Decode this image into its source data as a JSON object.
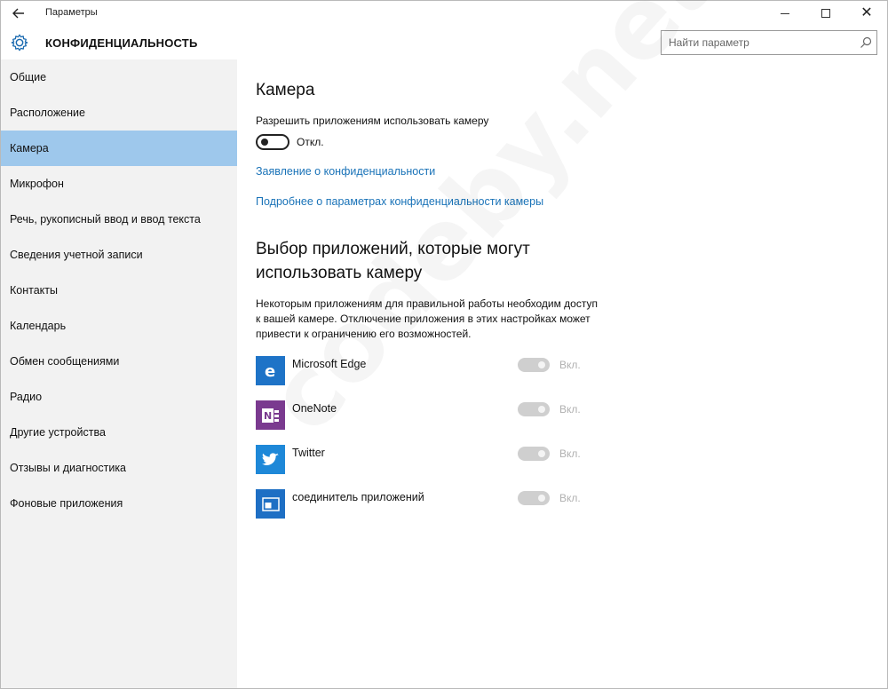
{
  "window": {
    "title": "Параметры",
    "back_icon": "arrow-left-icon",
    "controls": [
      "minimize-icon",
      "maximize-icon",
      "close-icon"
    ]
  },
  "header": {
    "title": "КОНФИДЕНЦИАЛЬНОСТЬ",
    "icon": "gear-icon",
    "search_placeholder": "Найти параметр",
    "search_icon": "search-icon"
  },
  "sidebar": {
    "active_index": 2,
    "items": [
      {
        "label": "Общие"
      },
      {
        "label": "Расположение"
      },
      {
        "label": "Камера"
      },
      {
        "label": "Микрофон"
      },
      {
        "label": "Речь, рукописный ввод и ввод текста"
      },
      {
        "label": "Сведения учетной записи"
      },
      {
        "label": "Контакты"
      },
      {
        "label": "Календарь"
      },
      {
        "label": "Обмен сообщениями"
      },
      {
        "label": "Радио"
      },
      {
        "label": "Другие устройства"
      },
      {
        "label": "Отзывы и диагностика"
      },
      {
        "label": "Фоновые приложения"
      }
    ]
  },
  "main": {
    "title": "Камера",
    "allow_label": "Разрешить приложениям использовать камеру",
    "allow_toggle": {
      "on": false,
      "state_label": "Откл."
    },
    "links": [
      "Заявление о конфиденциальности",
      "Подробнее о параметрах конфиденциальности камеры"
    ],
    "section_title": "Выбор приложений, которые могут использовать камеру",
    "section_description": "Некоторым приложениям для правильной работы необходим доступ к вашей камере. Отключение приложения в этих настройках может привести к ограничению его возможностей.",
    "apps": [
      {
        "name": "Microsoft Edge",
        "icon": "edge-icon",
        "color": "#1e73c7",
        "toggle_on": true,
        "toggle_enabled": false,
        "state_label": "Вкл."
      },
      {
        "name": "OneNote",
        "icon": "onenote-icon",
        "color": "#7a3a8f",
        "toggle_on": true,
        "toggle_enabled": false,
        "state_label": "Вкл."
      },
      {
        "name": "Twitter",
        "icon": "twitter-icon",
        "color": "#1e88d8",
        "toggle_on": true,
        "toggle_enabled": false,
        "state_label": "Вкл."
      },
      {
        "name": "соединитель приложений",
        "icon": "app-connector-icon",
        "color": "#1e6fc4",
        "toggle_on": true,
        "toggle_enabled": false,
        "state_label": "Вкл."
      }
    ]
  },
  "watermark": "codeby.net",
  "colors": {
    "accent_selected": "#9ec8ec",
    "link": "#1a73b8",
    "sidebar_bg": "#f2f2f2"
  }
}
